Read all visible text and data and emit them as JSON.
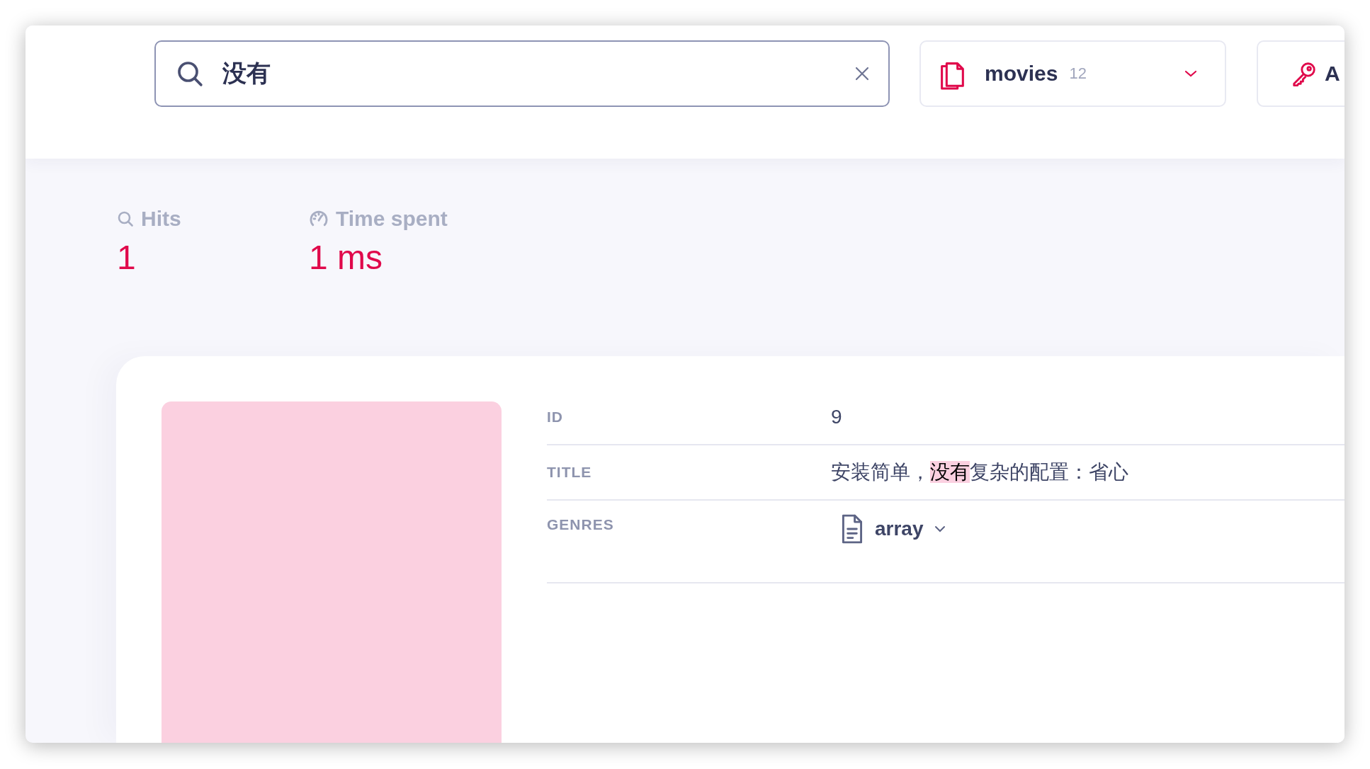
{
  "search": {
    "value": "没有"
  },
  "index_select": {
    "name": "movies",
    "count": "12"
  },
  "api_key_button": {
    "label": "A"
  },
  "stats": [
    {
      "kind": "hits",
      "label": "Hits",
      "value": "1"
    },
    {
      "kind": "time",
      "label": "Time spent",
      "value": "1 ms"
    }
  ],
  "document": {
    "fields": [
      {
        "label": "ID",
        "kind": "text",
        "parts": [
          {
            "text": "9",
            "highlighted": false
          }
        ]
      },
      {
        "label": "TITLE",
        "kind": "text",
        "parts": [
          {
            "text": "安装简单，",
            "highlighted": false
          },
          {
            "text": "没有",
            "highlighted": true
          },
          {
            "text": "复杂的配置：省心",
            "highlighted": false
          }
        ]
      },
      {
        "label": "GENRES",
        "kind": "array",
        "toggle": "array"
      }
    ]
  }
}
